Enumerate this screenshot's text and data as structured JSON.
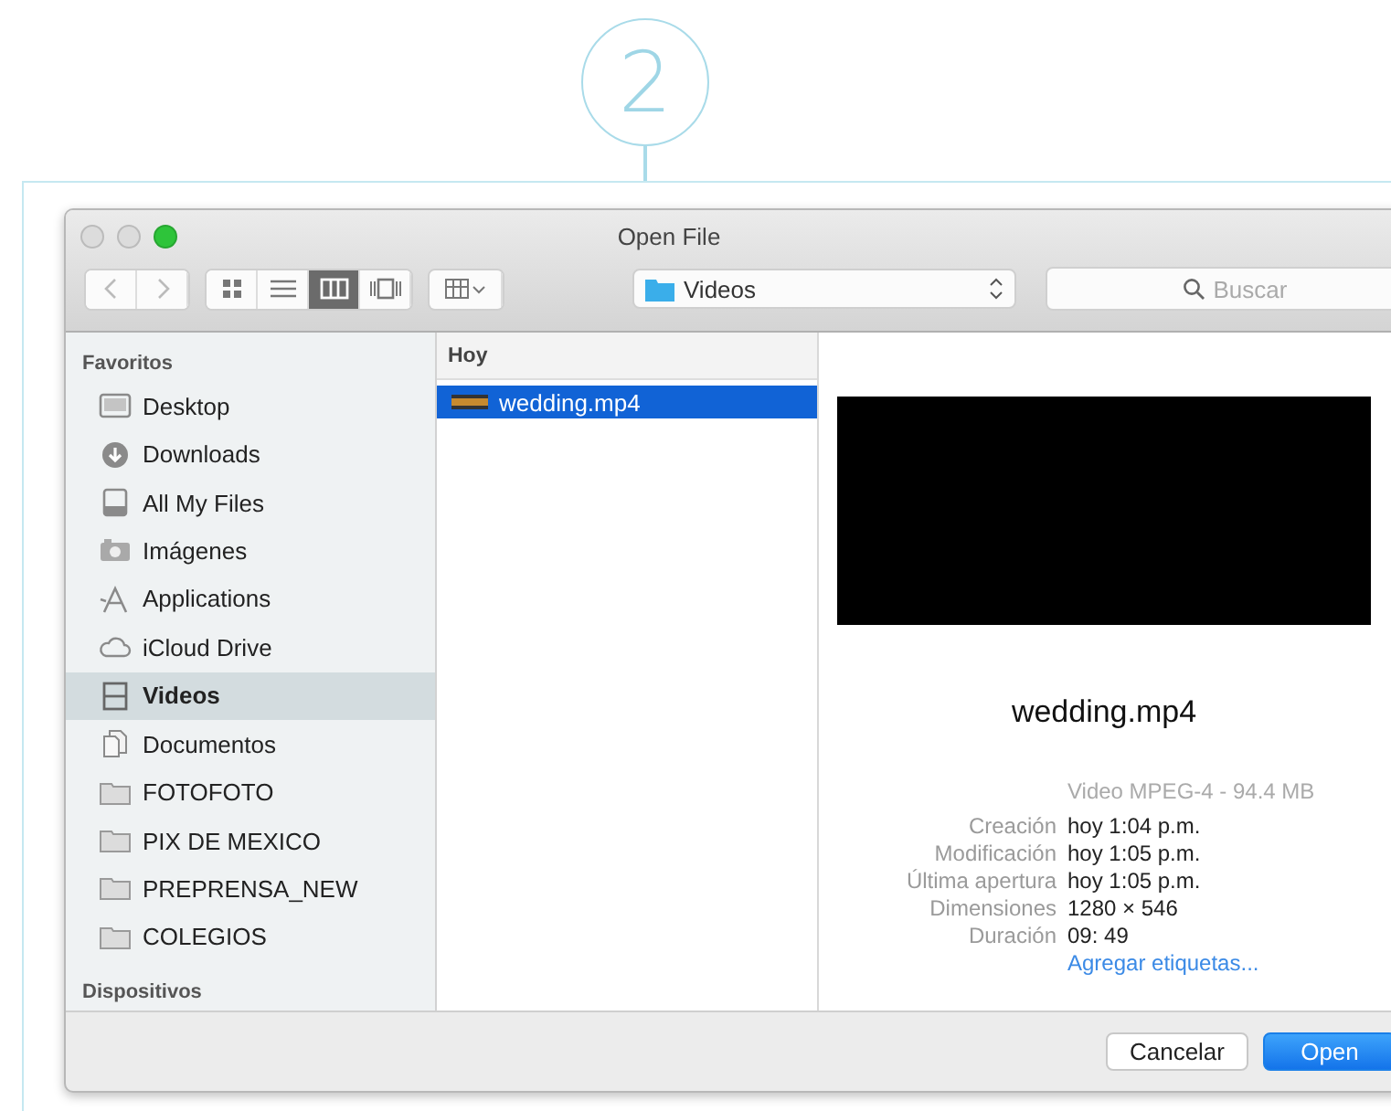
{
  "step": {
    "number": "2"
  },
  "window": {
    "title": "Open File"
  },
  "toolbar": {
    "view_modes": [
      {
        "kind": "icons",
        "selected": false
      },
      {
        "kind": "list",
        "selected": false
      },
      {
        "kind": "columns",
        "selected": true
      },
      {
        "kind": "coverflow",
        "selected": false
      }
    ],
    "location": "Videos",
    "search": {
      "placeholder": "Buscar"
    }
  },
  "sidebar": {
    "sections": [
      {
        "title": "Favoritos",
        "items": [
          {
            "kind": "desktop",
            "label": "Desktop",
            "selected": false
          },
          {
            "kind": "download",
            "label": "Downloads",
            "selected": false
          },
          {
            "kind": "files",
            "label": "All My Files",
            "selected": false
          },
          {
            "kind": "camera",
            "label": "Imágenes",
            "selected": false
          },
          {
            "kind": "apps",
            "label": "Applications",
            "selected": false
          },
          {
            "kind": "cloud",
            "label": "iCloud Drive",
            "selected": false
          },
          {
            "kind": "film",
            "label": "Videos",
            "selected": true
          },
          {
            "kind": "documents",
            "label": "Documentos",
            "selected": false
          },
          {
            "kind": "folder",
            "label": "FOTOFOTO",
            "selected": false
          },
          {
            "kind": "folder",
            "label": "PIX DE MEXICO",
            "selected": false
          },
          {
            "kind": "folder",
            "label": "PREPRENSA_NEW",
            "selected": false
          },
          {
            "kind": "folder",
            "label": "COLEGIOS",
            "selected": false
          }
        ]
      },
      {
        "title": "Dispositivos"
      }
    ]
  },
  "file_column": {
    "header": "Hoy",
    "files": [
      {
        "name": "wedding.mp4",
        "selected": true
      }
    ]
  },
  "preview": {
    "name": "wedding.mp4",
    "summary": "Video MPEG-4 - 94.4 MB",
    "details": [
      {
        "label": "Creación",
        "value": "hoy 1:04 p.m."
      },
      {
        "label": "Modificación",
        "value": "hoy 1:05 p.m."
      },
      {
        "label": "Última apertura",
        "value": "hoy 1:05 p.m."
      },
      {
        "label": "Dimensiones",
        "value": "1280 × 546"
      },
      {
        "label": "Duración",
        "value": "09: 49"
      }
    ],
    "tags_link": "Agregar etiquetas..."
  },
  "buttons": [
    {
      "label": "Cancelar",
      "kind": "secondary"
    },
    {
      "label": "Open",
      "kind": "primary"
    }
  ]
}
